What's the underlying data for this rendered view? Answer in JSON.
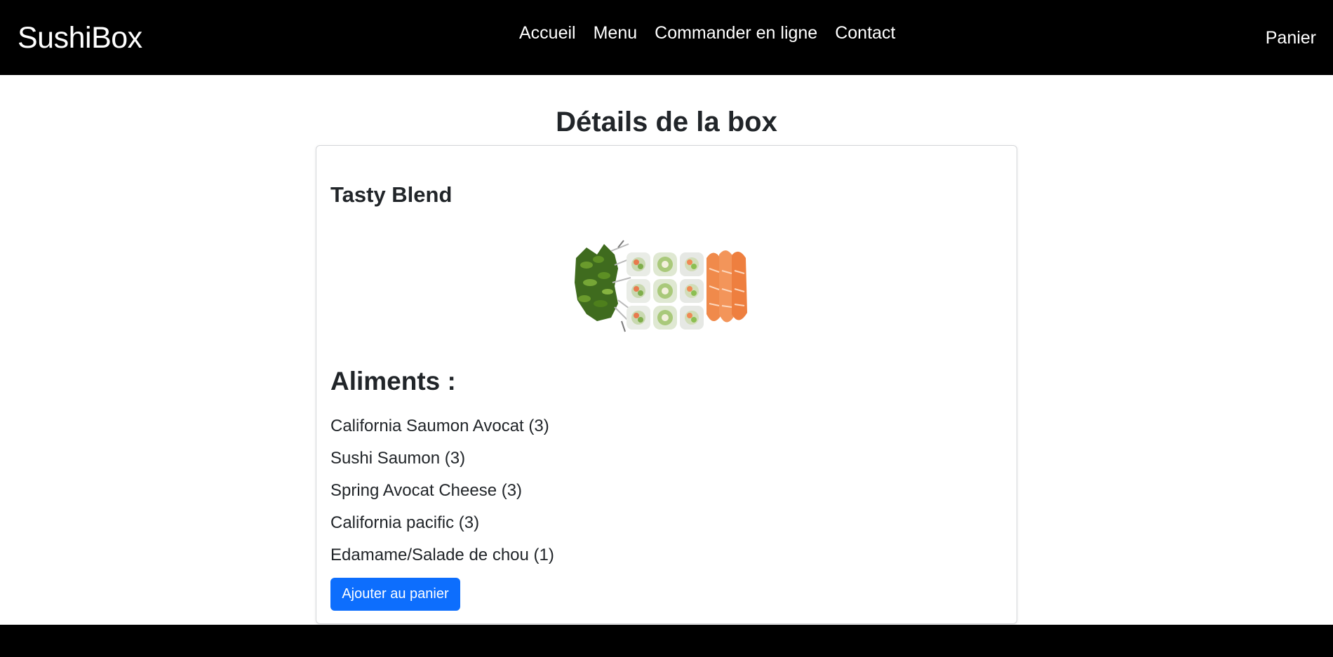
{
  "navbar": {
    "brand": "SushiBox",
    "links": [
      {
        "label": "Accueil"
      },
      {
        "label": "Menu"
      },
      {
        "label": "Commander en ligne"
      },
      {
        "label": "Contact"
      }
    ],
    "cart_label": "Panier"
  },
  "page": {
    "title": "Détails de la box"
  },
  "box": {
    "name": "Tasty Blend",
    "image_icon": "sushi-box-photo",
    "foods_title": "Aliments :",
    "foods": [
      {
        "label": "California Saumon Avocat (3)"
      },
      {
        "label": "Sushi Saumon (3)"
      },
      {
        "label": "Spring Avocat Cheese (3)"
      },
      {
        "label": "California pacific (3)"
      },
      {
        "label": "Edamame/Salade de chou (1)"
      }
    ],
    "add_button_label": "Ajouter au panier"
  },
  "colors": {
    "navbar_bg": "#000000",
    "primary_button": "#0d6efd",
    "text": "#212529"
  }
}
